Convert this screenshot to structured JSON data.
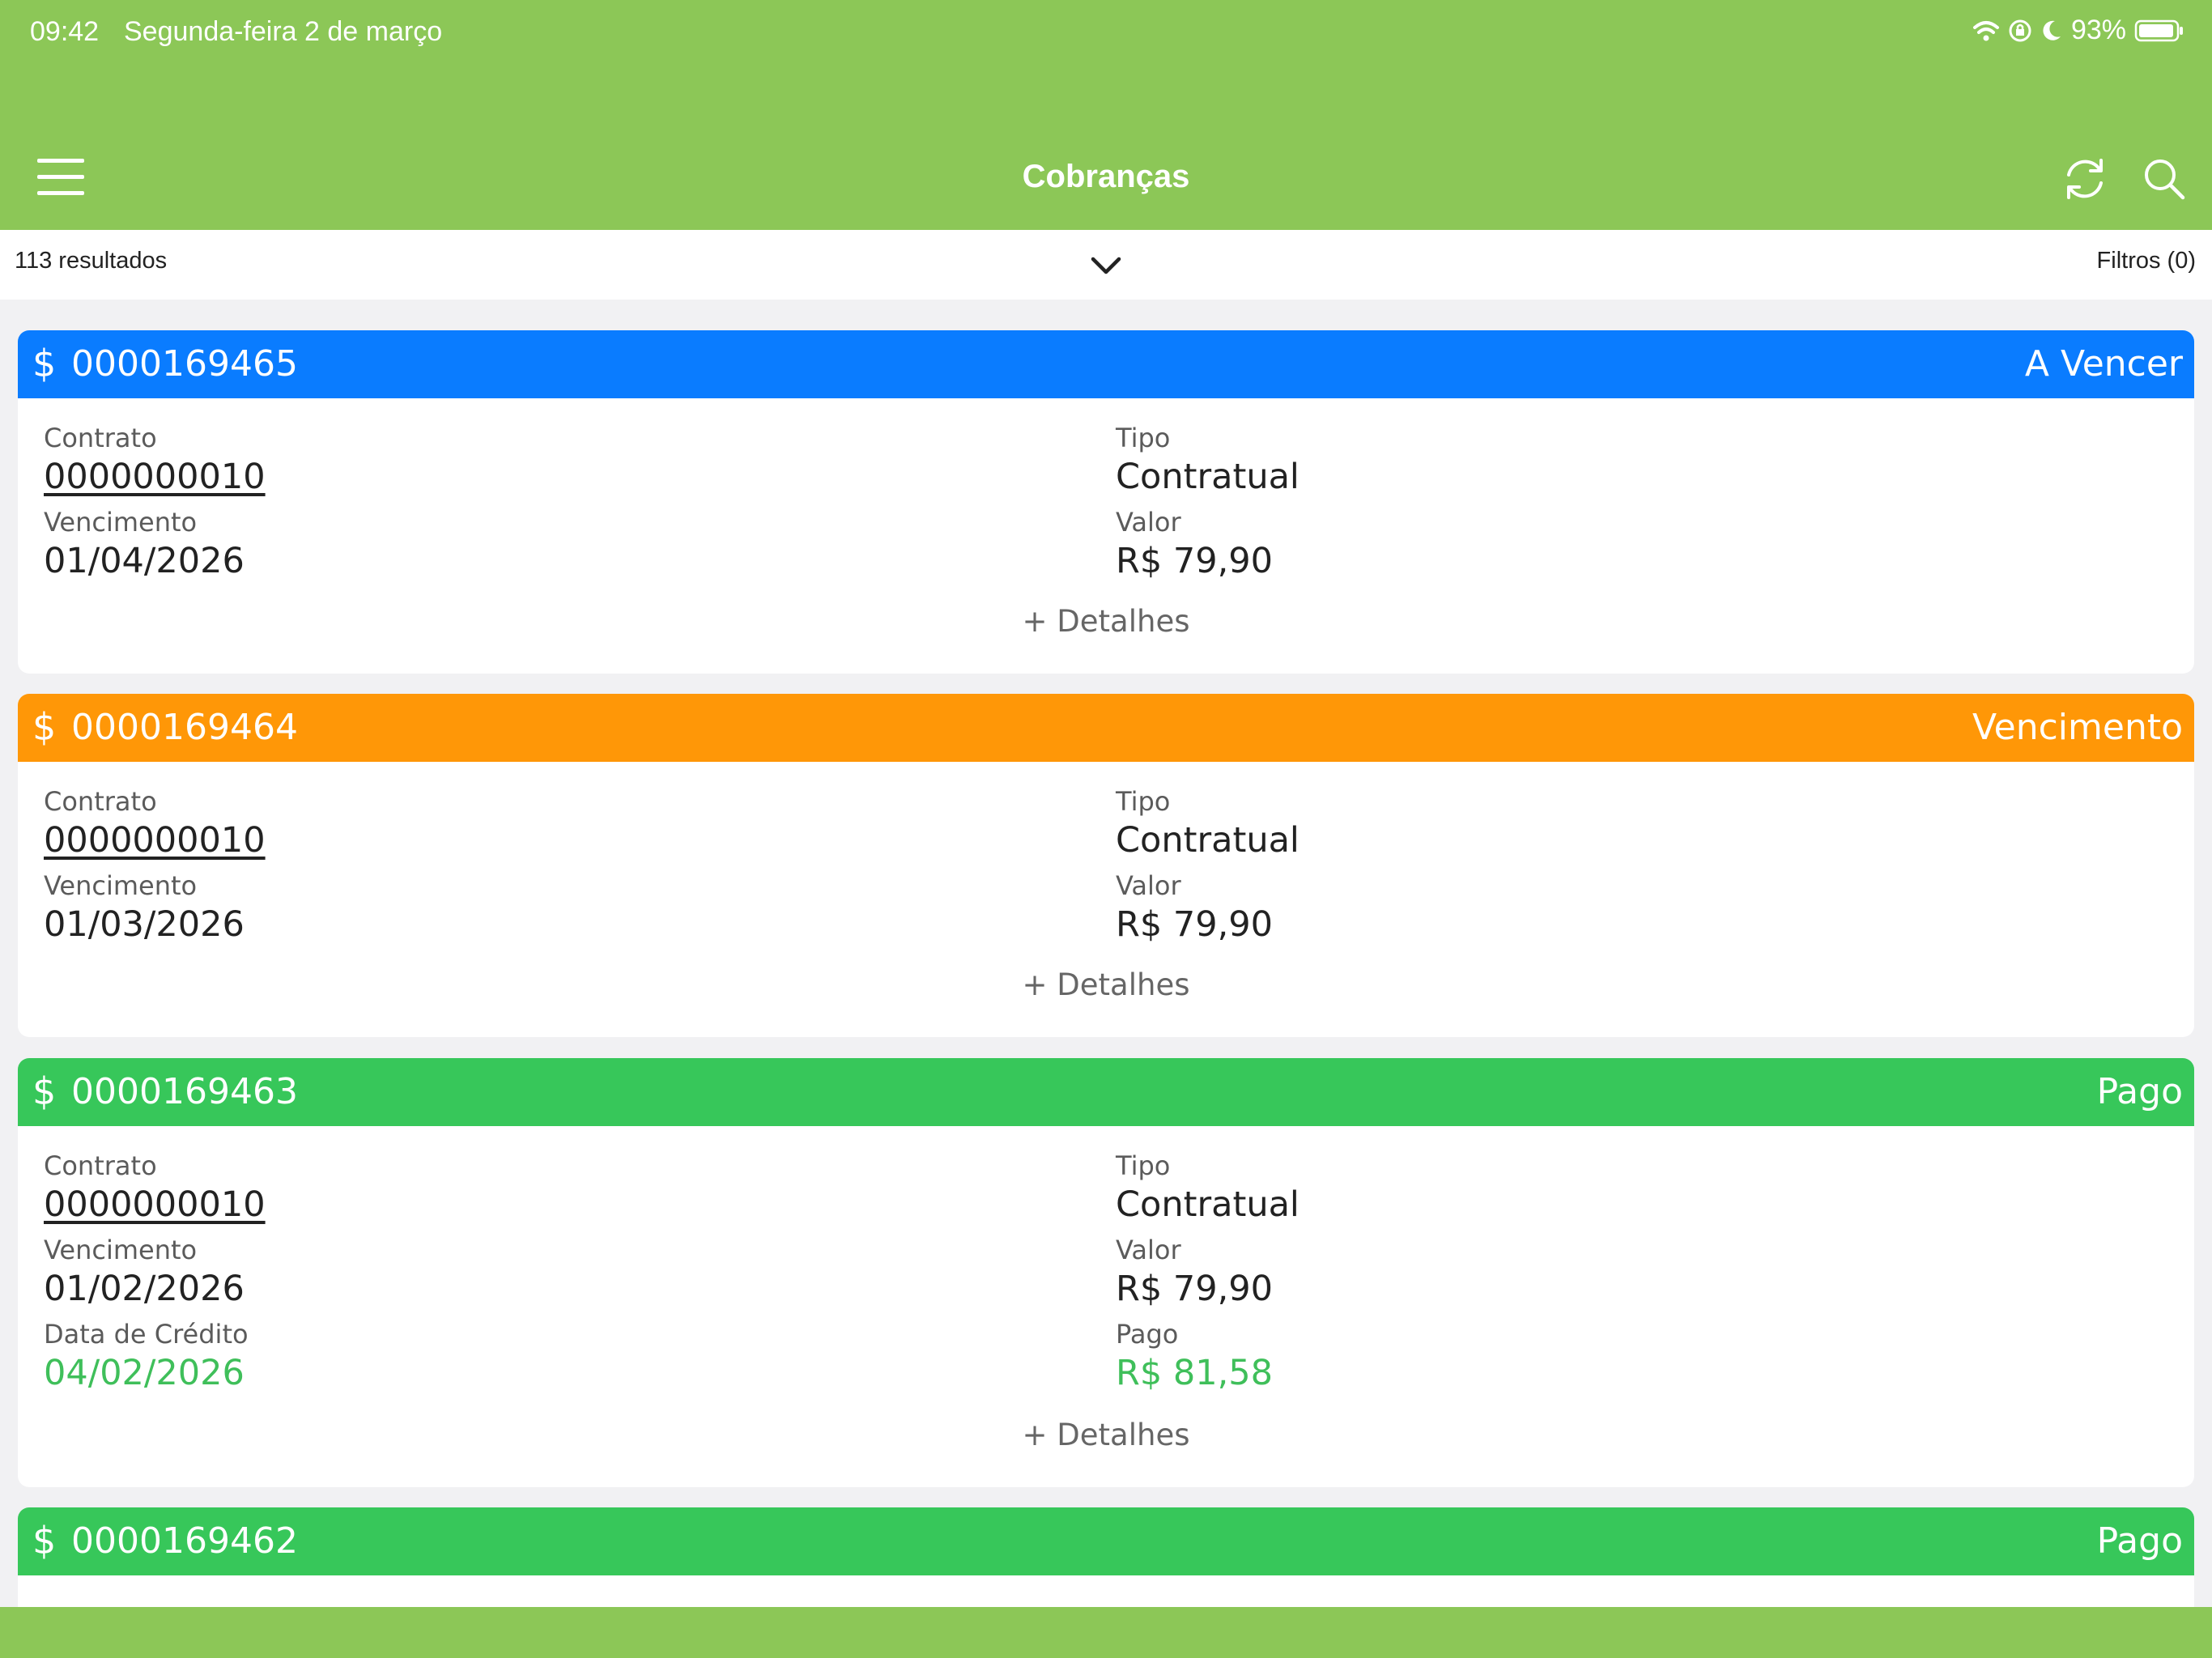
{
  "status_bar": {
    "time": "09:42",
    "date": "Segunda-feira 2 de março",
    "battery": "93%",
    "icons": [
      "wifi-icon",
      "orientation-lock-icon",
      "moon-icon",
      "battery-icon"
    ]
  },
  "header": {
    "title": "Cobranças",
    "icons": [
      "menu-icon",
      "refresh-icon",
      "search-icon"
    ]
  },
  "results": {
    "count_label": "113 resultados",
    "filters_label": "Filtros (0)"
  },
  "labels": {
    "contract": "Contrato",
    "type": "Tipo",
    "due": "Vencimento",
    "value": "Valor",
    "credit_date": "Data de Crédito",
    "paid": "Pago",
    "details": "+ Detalhes",
    "currency_symbol": "$"
  },
  "charges": [
    {
      "number": "0000169465",
      "status": "A Vencer",
      "color": "#0a7cff",
      "contract": "0000000010",
      "type": "Contratual",
      "due_date": "01/04/2026",
      "value": "R$ 79,90"
    },
    {
      "number": "0000169464",
      "status": "Vencimento",
      "color": "#ff9707",
      "contract": "0000000010",
      "type": "Contratual",
      "due_date": "01/03/2026",
      "value": "R$ 79,90"
    },
    {
      "number": "0000169463",
      "status": "Pago",
      "color": "#37c75a",
      "contract": "0000000010",
      "type": "Contratual",
      "due_date": "01/02/2026",
      "value": "R$ 79,90",
      "credit_date": "04/02/2026",
      "paid_value": "R$ 81,58"
    },
    {
      "number": "0000169462",
      "status": "Pago",
      "color": "#37c75a"
    }
  ],
  "colors": {
    "brand_green": "#8cc757",
    "paid_green_text": "#3fbf5a"
  }
}
